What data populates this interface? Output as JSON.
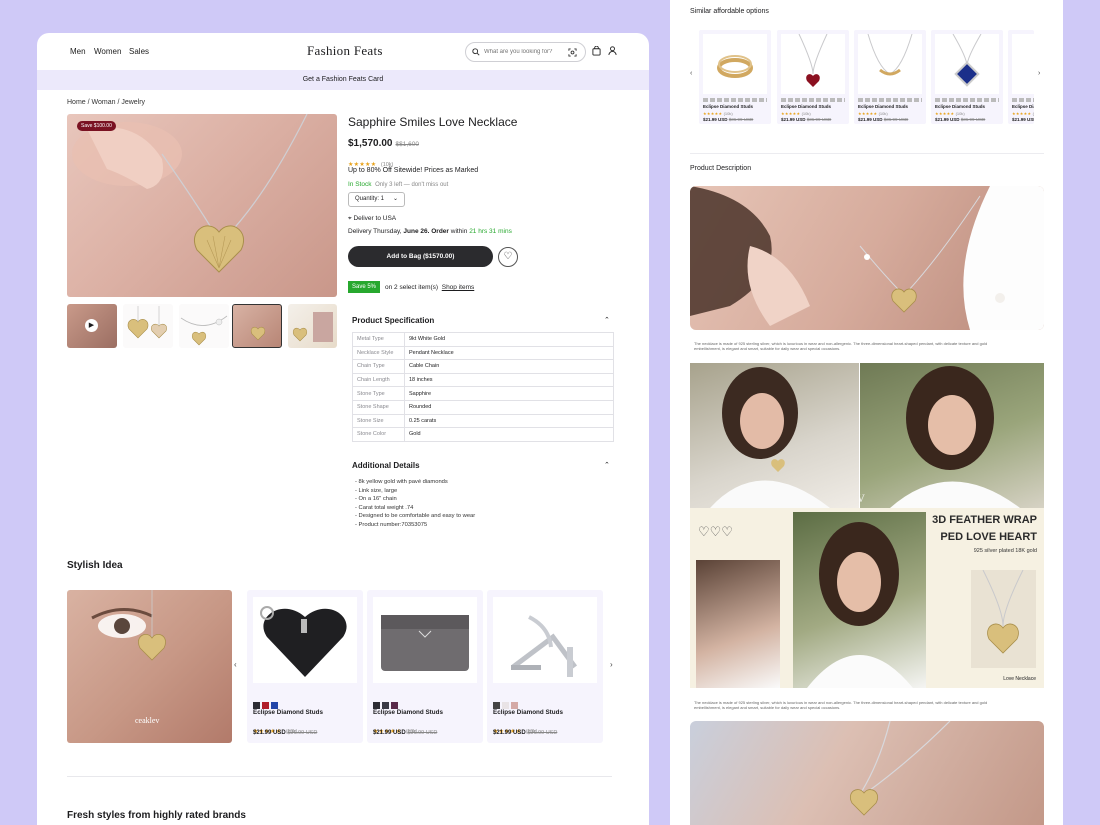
{
  "nav": {
    "men": "Men",
    "women": "Women",
    "sales": "Sales"
  },
  "brand": "Fashion Feats",
  "search": {
    "placeholder": "What are you looking for?"
  },
  "banner": "Get a Fashion Feats Card",
  "breadcrumb": "Home / Woman / Jewelry",
  "product": {
    "badge": "Save $100.00",
    "title": "Sapphire Smiles Love Necklace",
    "price": "$1,570.00",
    "old_price": "$$1,600",
    "rating_stars": "★★★★★",
    "rating_count": "(10k)",
    "promo": "Up to 80% Off Sitewide! Prices as Marked",
    "stock": "In Stock",
    "stock_note": "Only 3 left — don't miss out",
    "quantity": "Quantity: 1",
    "deliver": "Deliver to USA",
    "delivery_prefix": "Delivery Thursday,",
    "delivery_date": "June 26.",
    "delivery_order": "Order",
    "delivery_within": "within",
    "delivery_countdown": "21 hrs 31 mins",
    "add_to_bag": "Add to Bag ($1570.00)",
    "save_badge": "Save 5%",
    "save_text": "on 2 select item(s)",
    "shop_items": "Shop items"
  },
  "spec": {
    "title": "Product Specification",
    "rows": [
      [
        "Metal Type",
        "9kt White Gold"
      ],
      [
        "Necklace Style",
        "Pendant Necklace"
      ],
      [
        "Chain Type",
        "Cable Chain"
      ],
      [
        "Chain Length",
        "18 inches"
      ],
      [
        "Stone Type",
        "Sapphire"
      ],
      [
        "Stone Shape",
        "Rounded"
      ],
      [
        "Stone Size",
        "0.25 carats"
      ],
      [
        "Stone Color",
        "Gold"
      ]
    ]
  },
  "details": {
    "title": "Additional Details",
    "items": [
      "8k yellow gold with pavé diamonds",
      "Link size, large",
      "On a 16\" chain",
      "Carat total weight .74",
      "Designed to be comfortable and easy to wear",
      "Product number:70353075"
    ]
  },
  "stylish": {
    "title": "Stylish Idea",
    "watermark": "ceaklev",
    "products": [
      {
        "name": "Eclipse Diamond Studs",
        "stars": "★★★★★",
        "count": "(10k)",
        "price": "$21.99 USD",
        "old": "$36.99 USD",
        "swatches": [
          "#2c2c34",
          "#b01e2a",
          "#2346a8"
        ]
      },
      {
        "name": "Eclipse Diamond Studs",
        "stars": "★★★★★",
        "count": "(10k)",
        "price": "$21.99 USD",
        "old": "$36.99 USD",
        "swatches": [
          "#2c2c34",
          "#3a3a46",
          "#5a2a4a"
        ]
      },
      {
        "name": "Eclipse Diamond Studs",
        "stars": "★★★★★",
        "count": "(10k)",
        "price": "$21.99 USD",
        "old": "$36.99 USD",
        "swatches": [
          "#444",
          "#e9e3e6",
          "#d4a9a6"
        ]
      }
    ]
  },
  "fresh_title": "Fresh styles from highly rated brands",
  "right": {
    "similar_title": "Similar affordable options",
    "similar": [
      {
        "name": "Eclipse Diamond Studs",
        "price": "$21.99 USD",
        "old": "$36.99 USD",
        "count": "(10k)"
      },
      {
        "name": "Eclipse Diamond Studs",
        "price": "$21.99 USD",
        "old": "$36.99 USD",
        "count": "(10k)"
      },
      {
        "name": "Eclipse Diamond Studs",
        "price": "$21.99 USD",
        "old": "$36.99 USD",
        "count": "(10k)"
      },
      {
        "name": "Eclipse Diamond Studs",
        "price": "$21.99 USD",
        "old": "$36.99 USD",
        "count": "(10k)"
      },
      {
        "name": "Eclipse Diamond Studs",
        "price": "$21.99 USD",
        "old": "$36.99 USD",
        "count": "(10k)"
      }
    ],
    "desc_title": "Product Description",
    "fine_print": "The necklace is made of 925 sterling silver, which is luxurious in wear and non-allergenic. The three-dimensional heart-shaped pendant, with delicate texture and gold embellishment, is elegant and smart, suitable for daily wear and special occasions.",
    "ad_line1": "3D FEATHER WRAP",
    "ad_line2": "PED LOVE HEART",
    "ad_line3": "925 silver plated 18K gold",
    "ad_caption": "Love Necklace",
    "ad_watermark": "ceaklev",
    "star_glyph": "★★★★★",
    "accent": "#cfc9f7",
    "stock_green": "#27a82e"
  }
}
